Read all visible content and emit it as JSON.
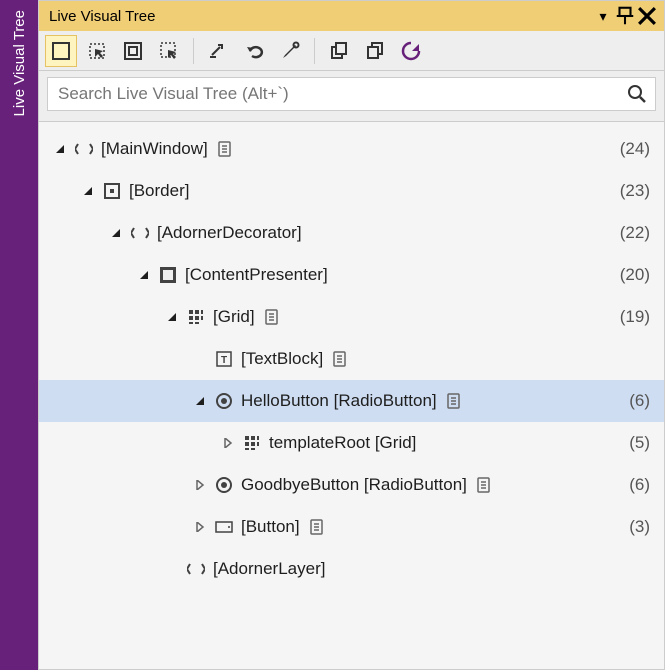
{
  "vtab": {
    "label": "Live Visual Tree"
  },
  "title_bar": {
    "title": "Live Visual Tree"
  },
  "toolbar": {
    "buttons": [
      {
        "name": "layout-adorners-icon"
      },
      {
        "name": "selection-icon"
      },
      {
        "name": "highlight-icon"
      },
      {
        "name": "display-options-icon"
      },
      {
        "name": "go-to-live-icon"
      },
      {
        "name": "undo-icon"
      },
      {
        "name": "settings-icon"
      },
      {
        "name": "collapse-all-icon"
      },
      {
        "name": "expand-all-icon"
      },
      {
        "name": "refresh-icon"
      }
    ]
  },
  "search": {
    "placeholder": "Search Live Visual Tree (Alt+`)"
  },
  "tree": {
    "rows": [
      {
        "indent": 0,
        "expander": "expanded",
        "icon": "angles",
        "label": "[MainWindow]",
        "hasSource": true,
        "count": "(24)",
        "selected": false
      },
      {
        "indent": 1,
        "expander": "expanded",
        "icon": "border",
        "label": "[Border]",
        "hasSource": false,
        "count": "(23)",
        "selected": false
      },
      {
        "indent": 2,
        "expander": "expanded",
        "icon": "angles",
        "label": "[AdornerDecorator]",
        "hasSource": false,
        "count": "(22)",
        "selected": false
      },
      {
        "indent": 3,
        "expander": "expanded",
        "icon": "content",
        "label": "[ContentPresenter]",
        "hasSource": false,
        "count": "(20)",
        "selected": false
      },
      {
        "indent": 4,
        "expander": "expanded",
        "icon": "grid",
        "label": "[Grid]",
        "hasSource": true,
        "count": "(19)",
        "selected": false
      },
      {
        "indent": 5,
        "expander": "none",
        "icon": "textblock",
        "label": "[TextBlock]",
        "hasSource": true,
        "count": "",
        "selected": false
      },
      {
        "indent": 5,
        "expander": "expanded",
        "icon": "radio",
        "label": "HelloButton [RadioButton]",
        "hasSource": true,
        "count": "(6)",
        "selected": true
      },
      {
        "indent": 6,
        "expander": "collapsed",
        "icon": "grid",
        "label": "templateRoot [Grid]",
        "hasSource": false,
        "count": "(5)",
        "selected": false
      },
      {
        "indent": 5,
        "expander": "collapsed",
        "icon": "radio",
        "label": "GoodbyeButton [RadioButton]",
        "hasSource": true,
        "count": "(6)",
        "selected": false
      },
      {
        "indent": 5,
        "expander": "collapsed",
        "icon": "button",
        "label": "[Button]",
        "hasSource": true,
        "count": "(3)",
        "selected": false
      },
      {
        "indent": 4,
        "expander": "none",
        "icon": "angles",
        "label": "[AdornerLayer]",
        "hasSource": false,
        "count": "",
        "selected": false
      }
    ]
  }
}
